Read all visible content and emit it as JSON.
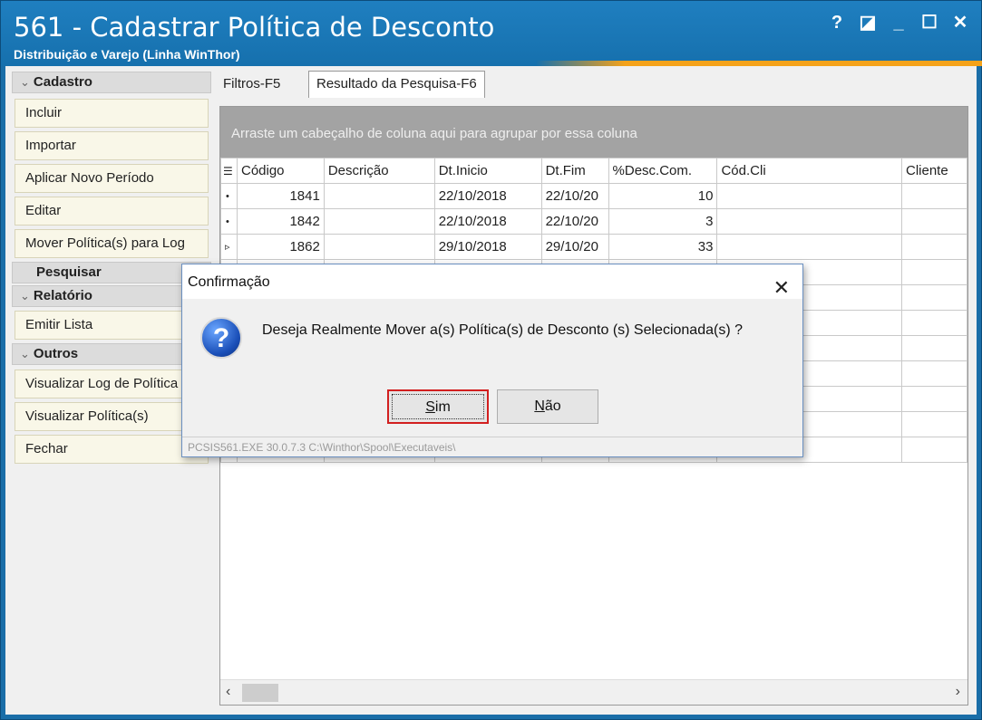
{
  "window": {
    "title": "561 - Cadastrar Política de Desconto",
    "subtitle": "Distribuição e Varejo (Linha WinThor)",
    "controls": [
      "?",
      "◪",
      "_",
      "☐",
      "✕"
    ]
  },
  "sidebar": {
    "cadastro_header": "Cadastro",
    "cadastro_items": [
      "Incluir",
      "Importar",
      "Aplicar Novo Período",
      "Editar",
      "Mover Política(s) para Log"
    ],
    "pesquisar_header": "Pesquisar",
    "relatorio_header": "Relatório",
    "relatorio_items": [
      "Emitir Lista"
    ],
    "outros_header": "Outros",
    "outros_items": [
      "Visualizar Log de Política",
      "Visualizar Política(s)",
      "Fechar"
    ]
  },
  "tabs": {
    "filtros": "Filtros-F5",
    "resultado": "Resultado da Pesquisa-F6"
  },
  "grid": {
    "group_hint": "Arraste um cabeçalho de coluna aqui para agrupar por essa coluna",
    "columns": [
      "Código",
      "Descrição",
      "Dt.Inicio",
      "Dt.Fim",
      "%Desc.Com.",
      "Cód.Cli",
      "Cliente"
    ],
    "rows": [
      {
        "marker": "•",
        "codigo": "1841",
        "descricao": "",
        "dt_inicio": "22/10/2018",
        "dt_fim": "22/10/20",
        "desc": "10",
        "cod_cli": "",
        "cliente": ""
      },
      {
        "marker": "•",
        "codigo": "1842",
        "descricao": "",
        "dt_inicio": "22/10/2018",
        "dt_fim": "22/10/20",
        "desc": "3",
        "cod_cli": "",
        "cliente": ""
      },
      {
        "marker": "▹",
        "codigo": "1862",
        "descricao": "",
        "dt_inicio": "29/10/2018",
        "dt_fim": "29/10/20",
        "desc": "33",
        "cod_cli": "",
        "cliente": ""
      }
    ]
  },
  "dialog": {
    "title": "Confirmação",
    "message": "Deseja Realmente Mover a(s) Política(s) de Desconto (s) Selecionada(s) ?",
    "yes_prefix": "S",
    "yes_rest": "im",
    "no_prefix": "N",
    "no_rest": "ão",
    "status": "PCSIS561.EXE 30.0.7.3 C:\\Winthor\\Spool\\Executaveis\\"
  },
  "colors": {
    "title_bg": "#1670ad",
    "accent": "#f4a21a",
    "default_button_border": "#d21f1f"
  }
}
